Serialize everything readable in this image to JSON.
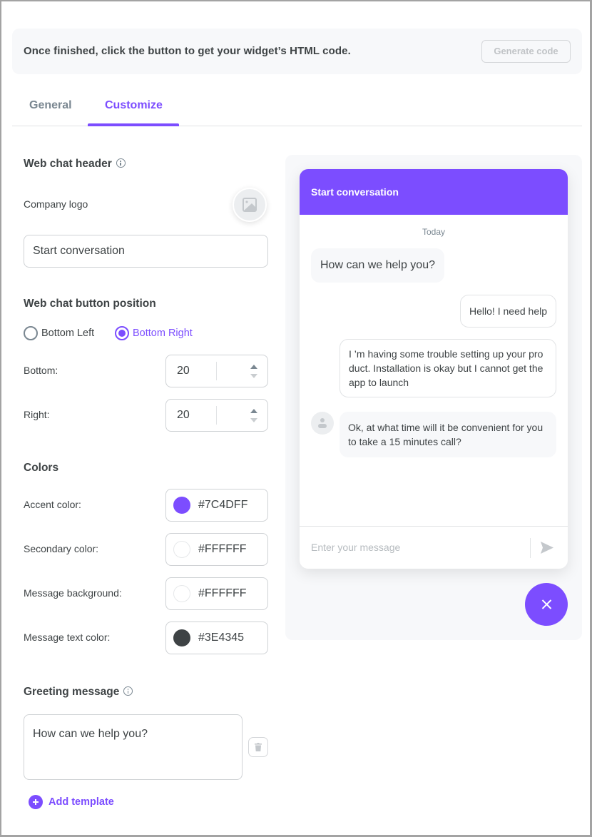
{
  "banner": {
    "text": "Once finished, click the button to get your widget’s HTML code.",
    "generate_button": "Generate code"
  },
  "tabs": [
    {
      "label": "General",
      "active": false
    },
    {
      "label": "Customize",
      "active": true
    }
  ],
  "header_section": {
    "title": "Web chat header",
    "logo_label": "Company logo",
    "title_input_value": "Start conversation"
  },
  "position_section": {
    "title": "Web chat button position",
    "options": [
      {
        "label": "Bottom Left",
        "selected": false
      },
      {
        "label": "Bottom Right",
        "selected": true
      }
    ],
    "bottom_label": "Bottom:",
    "bottom_value": "20",
    "right_label": "Right:",
    "right_value": "20"
  },
  "colors_section": {
    "title": "Colors",
    "items": [
      {
        "label": "Accent color:",
        "value": "#7C4DFF"
      },
      {
        "label": "Secondary color:",
        "value": "#FFFFFF"
      },
      {
        "label": "Message background:",
        "value": "#FFFFFF"
      },
      {
        "label": "Message text color:",
        "value": "#3E4345"
      }
    ]
  },
  "greeting_section": {
    "title": "Greeting message",
    "message": "How can we help you?",
    "add_template": "Add template"
  },
  "preview": {
    "header_title": "Start conversation",
    "date_label": "Today",
    "messages": [
      {
        "from": "agent",
        "text": "How can we help you?"
      },
      {
        "from": "user",
        "text": "Hello! I need help"
      },
      {
        "from": "user",
        "text": "I ’m having some trouble setting up your pro duct. Installation is okay but I cannot get the app to launch"
      },
      {
        "from": "agent",
        "text": "Ok, at what time will it be convenient for you to take a 15 minutes call?"
      }
    ],
    "input_placeholder": "Enter your message"
  }
}
